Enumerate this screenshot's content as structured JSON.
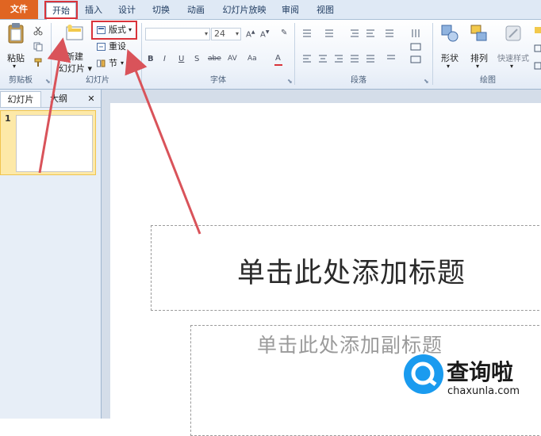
{
  "tabs": {
    "file": "文件",
    "home": "开始",
    "insert": "插入",
    "design": "设计",
    "transitions": "切换",
    "animations": "动画",
    "slideshow": "幻灯片放映",
    "review": "审阅",
    "view": "视图"
  },
  "ribbon": {
    "clipboard": {
      "paste": "粘贴",
      "group": "剪贴板"
    },
    "slides": {
      "new_slide_line1": "新建",
      "new_slide_line2": "幻灯片",
      "layout": "版式",
      "reset": "重设",
      "section": "节",
      "group": "幻灯片"
    },
    "font": {
      "font_name": "",
      "font_size": "24",
      "bold": "B",
      "italic": "I",
      "underline": "U",
      "strike": "S",
      "abc": "abe",
      "av": "AV",
      "aa": "Aa",
      "color_a": "A",
      "group": "字体"
    },
    "paragraph": {
      "group": "段落"
    },
    "drawing": {
      "shapes": "形状",
      "arrange": "排列",
      "quick_styles": "快速样式",
      "group": "绘图"
    }
  },
  "pane": {
    "tab_slides": "幻灯片",
    "tab_outline": "大纲",
    "close": "✕",
    "slide_number": "1"
  },
  "slide": {
    "title_placeholder": "单击此处添加标题",
    "subtitle_placeholder": "单击此处添加副标题"
  },
  "watermark": {
    "brand": "查询啦",
    "url": "chaxunla.com"
  },
  "colors": {
    "file_tab": "#e06522",
    "highlight_box": "#d9333a",
    "arrow": "#d9535a",
    "thumb_selected": "#fde9a8",
    "watermark_blue": "#1a9bef"
  }
}
